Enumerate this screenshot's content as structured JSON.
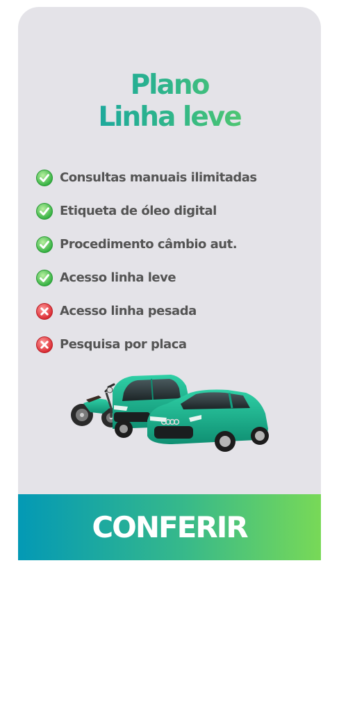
{
  "plan": {
    "title_line1": "Plano",
    "title_line2": "Linha leve"
  },
  "features": [
    {
      "label": "Consultas manuais ilimitadas",
      "included": true
    },
    {
      "label": "Etiqueta de óleo digital",
      "included": true
    },
    {
      "label": "Procedimento câmbio aut.",
      "included": true
    },
    {
      "label": "Acesso linha leve",
      "included": true
    },
    {
      "label": "Acesso linha pesada",
      "included": false
    },
    {
      "label": "Pesquisa por placa",
      "included": false
    }
  ],
  "cta": {
    "label": "CONFERIR"
  },
  "colors": {
    "card_bg": "#e4e3e8",
    "gradient_start": "#0399b5",
    "gradient_end": "#78d957",
    "check_green": "#49c24a",
    "cross_red": "#e0343a",
    "text": "#545454",
    "vehicle_teal": "#17b58f"
  }
}
